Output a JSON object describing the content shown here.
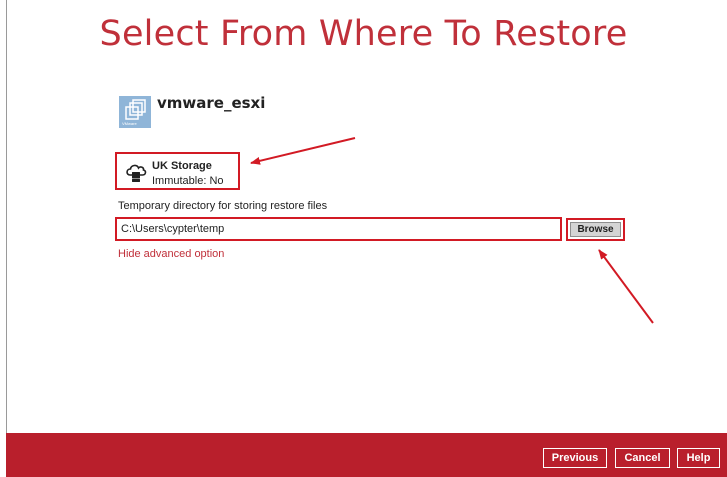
{
  "page": {
    "title": "Select From Where To Restore"
  },
  "source": {
    "name": "vmware_esxi",
    "icon": "vmware-icon",
    "icon_caption": "VMware"
  },
  "storage": {
    "name": "UK Storage",
    "immutable": "Immutable: No",
    "icon": "cloud-storage-icon"
  },
  "restore": {
    "temp_dir_label": "Temporary directory for storing restore files",
    "temp_dir_value": "C:\\Users\\cypter\\temp",
    "browse_label": "Browse",
    "advanced_link": "Hide advanced option"
  },
  "footer": {
    "previous_label": "Previous",
    "cancel_label": "Cancel",
    "help_label": "Help"
  },
  "colors": {
    "accent": "#c0303a",
    "footer": "#b91f2c",
    "highlight": "#d21a24"
  }
}
